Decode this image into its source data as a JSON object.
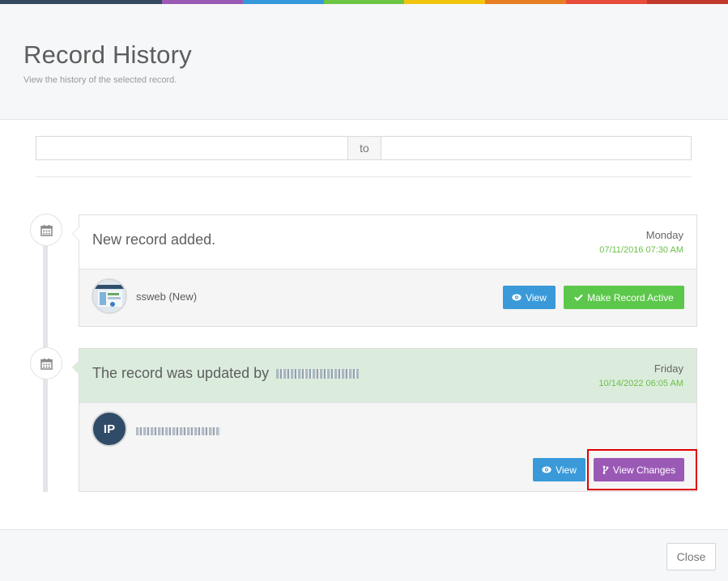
{
  "colors": {
    "bar": [
      "#35495e",
      "#9b59b6",
      "#3498db",
      "#6cc644",
      "#f1c40f",
      "#e67e22",
      "#e74c3c",
      "#c0392b"
    ],
    "accent_green": "#6cbf4a",
    "button_blue": "#3a9ad9",
    "button_green": "#5cc84b",
    "button_purple": "#9b59b6"
  },
  "header": {
    "title": "Record History",
    "subtitle": "View the history of the selected record."
  },
  "range": {
    "from_value": "",
    "to_label": "to",
    "until_value": ""
  },
  "timeline": [
    {
      "icon": "calendar-icon",
      "text": "New record added.",
      "day": "Monday",
      "timestamp": "07/11/2016 07:30 AM",
      "user": "ssweb (New)",
      "view_label": "View",
      "action_label": "Make Record Active",
      "action_icon": "check-icon"
    },
    {
      "icon": "calendar-icon",
      "text": "The record was updated by",
      "day": "Friday",
      "timestamp": "10/14/2022 06:05 AM",
      "avatar_initials": "IP",
      "view_label": "View",
      "action_label": "View Changes",
      "action_icon": "branch-icon"
    }
  ],
  "footer": {
    "close_label": "Close"
  }
}
